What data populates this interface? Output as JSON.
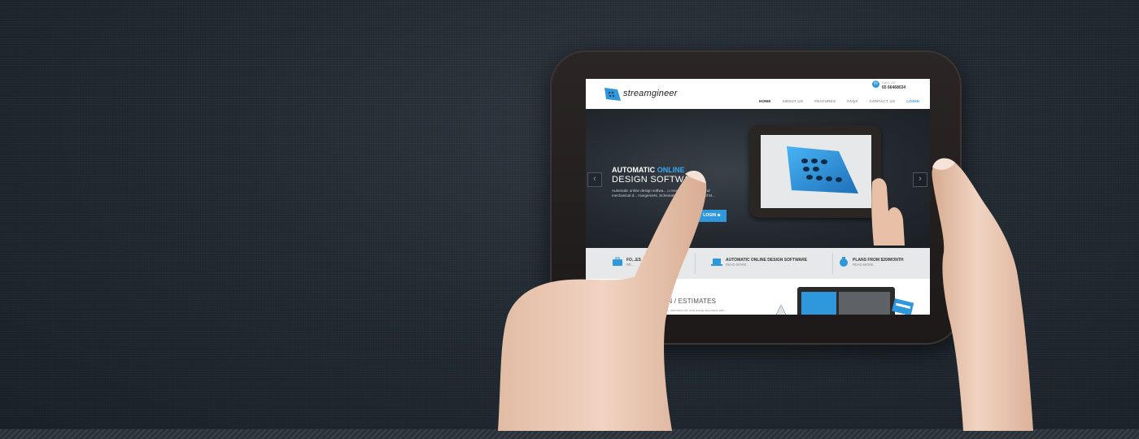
{
  "site": {
    "logo_text": "streamgineer",
    "call_label": "CALL US",
    "call_number": "65 66468034",
    "nav": [
      "HOME",
      "ABOUT US",
      "FEATURES",
      "FAQS",
      "CONTACT US",
      "LOGIN"
    ]
  },
  "hero": {
    "title_part1": "AUTOMATIC",
    "title_part2": "ONLINE",
    "title_line2": "DESIGN SOFTWA",
    "description": "Automatic online design softwa... o create full electrical and mechanical d... rrangement, Schematic Design, and Bill of M...",
    "login_label": "LOGIN",
    "prev_label": "‹",
    "next_label": "›"
  },
  "features": [
    {
      "title": "FO...ES",
      "link": "RE..."
    },
    {
      "title": "AUTOMATIC ONLINE DESIGN SOFTWARE",
      "link": "READ MORE"
    },
    {
      "title": "PLANS FROM $20/MONTH",
      "link": "READ MORE"
    }
  ],
  "section": {
    "title": "SIGN / ESTIMATES",
    "text": "...ntation, alteration kit, and sharp accuracy with..."
  },
  "colors": {
    "accent": "#2f97db",
    "background": "#222a32",
    "tablet_bezel": "#231e1d"
  }
}
